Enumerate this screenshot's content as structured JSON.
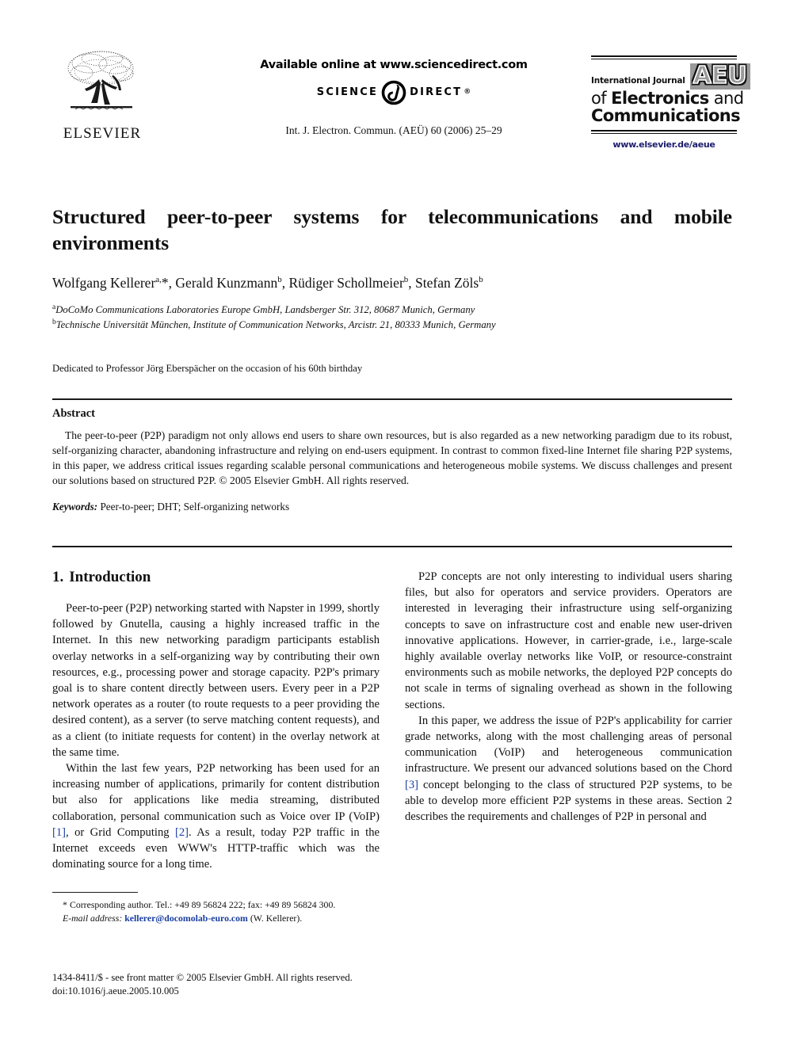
{
  "masthead": {
    "publisher_name": "ELSEVIER",
    "publisher_logo_icon": "elsevier-tree-icon",
    "available_online": "Available online at www.sciencedirect.com",
    "sciencedirect_science": "SCIENCE",
    "sciencedirect_at_icon": "at-sign-icon",
    "sciencedirect_direct": "DIRECT",
    "sciencedirect_registered": "®",
    "journal_reference": "Int. J. Electron. Commun. (AEÜ) 60 (2006) 25–29"
  },
  "journal_logo": {
    "line_intl": "International Journal",
    "badge": "AEU",
    "line_of": "of ",
    "line_electronics": "Electronics",
    "line_and": " and",
    "line_communications": "Communications",
    "url": "www.elsevier.de/aeue",
    "url_color": "#1c1c6e"
  },
  "article": {
    "title": "Structured peer-to-peer systems for telecommunications and mobile environments",
    "authors_html": "Wolfgang Kellerer<sup>a,</sup>*, Gerald Kunzmann<sup>b</sup>, Rüdiger Schollmeier<sup>b</sup>, Stefan Zöls<sup>b</sup>",
    "affiliations": [
      {
        "marker": "a",
        "text": "DoCoMo Communications Laboratories Europe GmbH, Landsberger Str. 312, 80687 Munich, Germany"
      },
      {
        "marker": "b",
        "text": "Technische Universität München, Institute of Communication Networks, Arcistr. 21, 80333 Munich, Germany"
      }
    ],
    "dedication": "Dedicated to Professor Jörg Eberspächer on the occasion of his 60th birthday"
  },
  "abstract": {
    "heading": "Abstract",
    "body": "The peer-to-peer (P2P) paradigm not only allows end users to share own resources, but is also regarded as a new networking paradigm due to its robust, self-organizing character, abandoning infrastructure and relying on end-users equipment. In contrast to common fixed-line Internet file sharing P2P systems, in this paper, we address critical issues regarding scalable personal communications and heterogeneous mobile systems. We discuss challenges and present our solutions based on structured P2P. © 2005 Elsevier GmbH. All rights reserved.",
    "keywords_label": "Keywords:",
    "keywords_value": "Peer-to-peer; DHT; Self-organizing networks"
  },
  "introduction": {
    "number": "1.",
    "heading": "Introduction",
    "paragraph_1": "Peer-to-peer (P2P) networking started with Napster in 1999, shortly followed by Gnutella, causing a highly increased traffic in the Internet. In this new networking paradigm participants establish overlay networks in a self-organizing way by contributing their own resources, e.g., processing power and storage capacity. P2P's primary goal is to share content directly between users. Every peer in a P2P network operates as a router (to route requests to a peer providing the desired content), as a server (to serve matching content requests), and as a client (to initiate requests for content) in the overlay network at the same time.",
    "paragraph_2_part1": "Within the last few years, P2P networking has been used for an increasing number of applications, primarily for content distribution but also for applications like media streaming, distributed collaboration, personal communication such as Voice over IP (VoIP) ",
    "paragraph_2_ref1": "[1]",
    "paragraph_2_part2": ", or Grid Computing ",
    "paragraph_2_ref2": "[2]",
    "paragraph_2_part3": ". As a result, today P2P traffic in the Internet exceeds even WWW's HTTP-traffic which was the dominating source for a long time.",
    "paragraph_3": "P2P concepts are not only interesting to individual users sharing files, but also for operators and service providers. Operators are interested in leveraging their infrastructure using self-organizing concepts to save on infrastructure cost and enable new user-driven innovative applications. However, in carrier-grade, i.e., large-scale highly available overlay networks like VoIP, or resource-constraint environments such as mobile networks, the deployed P2P concepts do not scale in terms of signaling overhead as shown in the following sections.",
    "paragraph_4_part1": "In this paper, we address the issue of P2P's applicability for carrier grade networks, along with the most challenging areas of personal communication (VoIP) and heterogeneous communication infrastructure. We present our advanced solutions based on the Chord ",
    "paragraph_4_ref3": "[3]",
    "paragraph_4_part2": " concept belonging to the class of structured P2P systems, to be able to develop more efficient P2P systems in these areas. Section 2 describes the requirements and challenges of P2P in personal and"
  },
  "footnote": {
    "star": "*",
    "corresponding": "Corresponding author. Tel.: +49 89 56824 222; fax: +49 89 56824 300.",
    "email_label": "E-mail address:",
    "email": "kellerer@docomolab-euro.com",
    "email_suffix": "(W. Kellerer).",
    "link_color": "#1b3fa0"
  },
  "imprint": {
    "issn_line": "1434-8411/$ - see front matter © 2005 Elsevier GmbH. All rights reserved.",
    "doi_line": "doi:10.1016/j.aeue.2005.10.005"
  }
}
